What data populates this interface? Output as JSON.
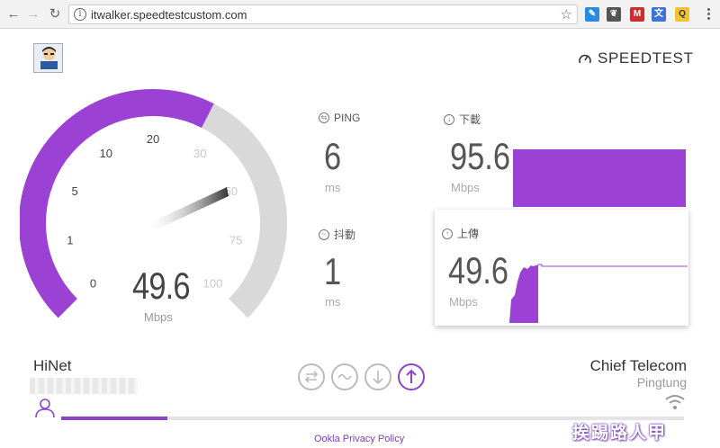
{
  "browser": {
    "url": "itwalker.speedtestcustom.com"
  },
  "header": {
    "brand": "SPEEDTEST",
    "avatar_text": "挨踢路人甲"
  },
  "gauge": {
    "value": "49.6",
    "unit": "Mbps",
    "scale_labels": [
      "0",
      "1",
      "5",
      "10",
      "20",
      "30",
      "50",
      "75",
      "100"
    ],
    "fill_fraction": 0.6
  },
  "metrics": {
    "ping": {
      "label": "PING",
      "value": "6",
      "unit": "ms"
    },
    "jitter": {
      "label": "抖動",
      "value": "1",
      "unit": "ms"
    },
    "download": {
      "label": "下載",
      "value": "95.6",
      "unit": "Mbps"
    },
    "upload": {
      "label": "上傳",
      "value": "49.6",
      "unit": "Mbps"
    }
  },
  "connection": {
    "isp": "HiNet",
    "server": "Chief Telecom",
    "location": "Pingtung",
    "progress": 0.17
  },
  "footer": {
    "privacy_link": "Ookla Privacy Policy",
    "watermark": "挨踢路人甲"
  },
  "colors": {
    "accent": "#9b41d3",
    "track": "#d9d9d9"
  }
}
